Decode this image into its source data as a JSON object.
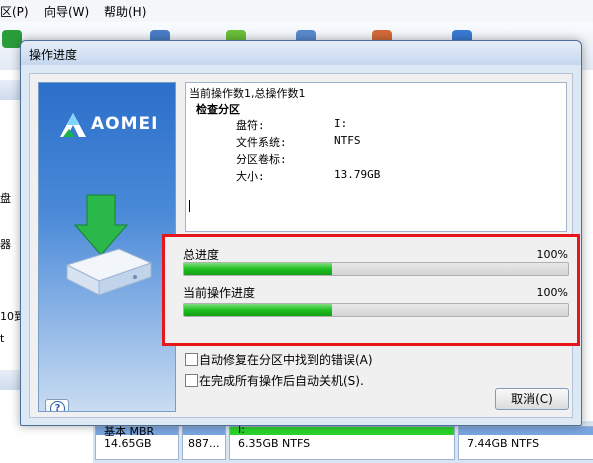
{
  "background": {
    "menu": [
      "区(P)",
      "向导(W)",
      "帮助(H)"
    ],
    "left_labels": [
      "盘",
      "器",
      "10到",
      "t"
    ],
    "partitions": [
      {
        "label": "基本 MBR",
        "size": "14.65GB",
        "color": "#7aa7e0"
      },
      {
        "label": "887...",
        "size": "",
        "color": "#7aa7e0"
      },
      {
        "label": "I:",
        "size": "6.35GB NTFS",
        "color": "#2bd52b"
      },
      {
        "label": "",
        "size": "7.44GB NTFS",
        "color": "#7aa7e0"
      }
    ]
  },
  "dialog": {
    "title": "操作进度",
    "brand": "AOMEI",
    "log": {
      "header": "当前操作数1,总操作数1",
      "section": "检查分区",
      "rows": [
        {
          "label": "盘符:",
          "value": "I:"
        },
        {
          "label": "文件系统:",
          "value": "NTFS"
        },
        {
          "label": "分区卷标:",
          "value": ""
        },
        {
          "label": "大小:",
          "value": "13.79GB"
        }
      ]
    },
    "progress": {
      "total_label": "总进度",
      "total_percent_text": "100%",
      "total_fill": 0.385,
      "current_label": "当前操作进度",
      "current_percent_text": "100%",
      "current_fill": 0.385
    },
    "options": [
      {
        "label": "自动修复在分区中找到的错误(A)",
        "checked": false
      },
      {
        "label": "在完成所有操作后自动关机(S).",
        "checked": false
      }
    ],
    "cancel_label": "取消(C)",
    "help_symbol": "?"
  },
  "colors": {
    "highlight": "#e8151b",
    "progress": "#1fbf1f",
    "brand_blue": "#2c6fc9"
  }
}
